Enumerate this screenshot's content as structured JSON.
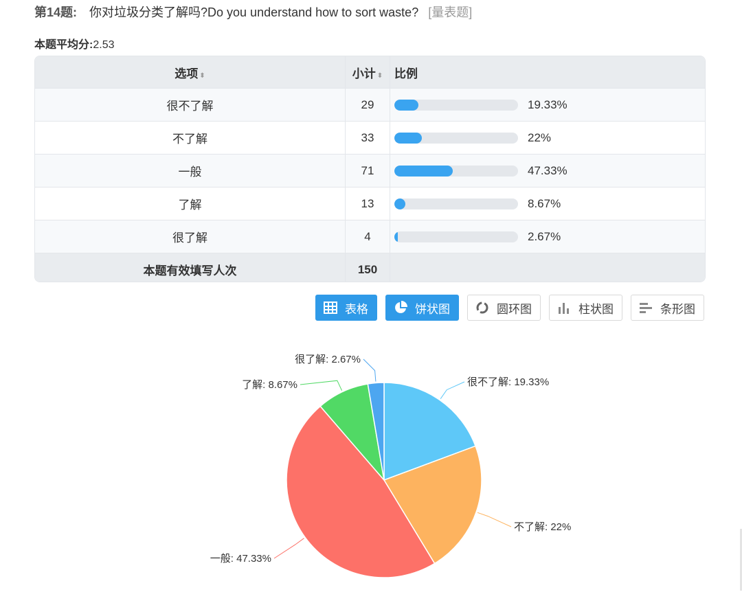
{
  "question": {
    "number_label": "第14题:",
    "text": "你对垃圾分类了解吗?Do you understand how to sort waste?",
    "tag": "[量表题]"
  },
  "average": {
    "label": "本题平均分:",
    "value": "2.53"
  },
  "table": {
    "headers": {
      "option": "选项",
      "count": "小计",
      "ratio": "比例"
    },
    "rows": [
      {
        "option": "很不了解",
        "count": "29",
        "percent": "19.33%",
        "fraction": 0.1933
      },
      {
        "option": "不了解",
        "count": "33",
        "percent": "22%",
        "fraction": 0.22
      },
      {
        "option": "一般",
        "count": "71",
        "percent": "47.33%",
        "fraction": 0.4733
      },
      {
        "option": "了解",
        "count": "13",
        "percent": "8.67%",
        "fraction": 0.0867
      },
      {
        "option": "很了解",
        "count": "4",
        "percent": "2.67%",
        "fraction": 0.0267
      }
    ],
    "total": {
      "label": "本题有效填写人次",
      "value": "150"
    }
  },
  "buttons": {
    "table": "表格",
    "pie": "饼状图",
    "donut": "圆环图",
    "column": "柱状图",
    "bar": "条形图"
  },
  "chart_data": {
    "type": "pie",
    "slices": [
      {
        "label": "很不了解",
        "value": 19.33,
        "color": "#5ec8f8",
        "display": "很不了解: 19.33%"
      },
      {
        "label": "不了解",
        "value": 22,
        "color": "#fdb35f",
        "display": "不了解: 22%"
      },
      {
        "label": "一般",
        "value": 47.33,
        "color": "#fd7168",
        "display": "一般: 47.33%"
      },
      {
        "label": "了解",
        "value": 8.67,
        "color": "#51d965",
        "display": "了解: 8.67%"
      },
      {
        "label": "很了解",
        "value": 2.67,
        "color": "#4da6f0",
        "display": "很了解: 2.67%"
      }
    ]
  },
  "colors": {
    "accent": "#2f9ae8",
    "bar_fill": "#3aa4f0"
  }
}
